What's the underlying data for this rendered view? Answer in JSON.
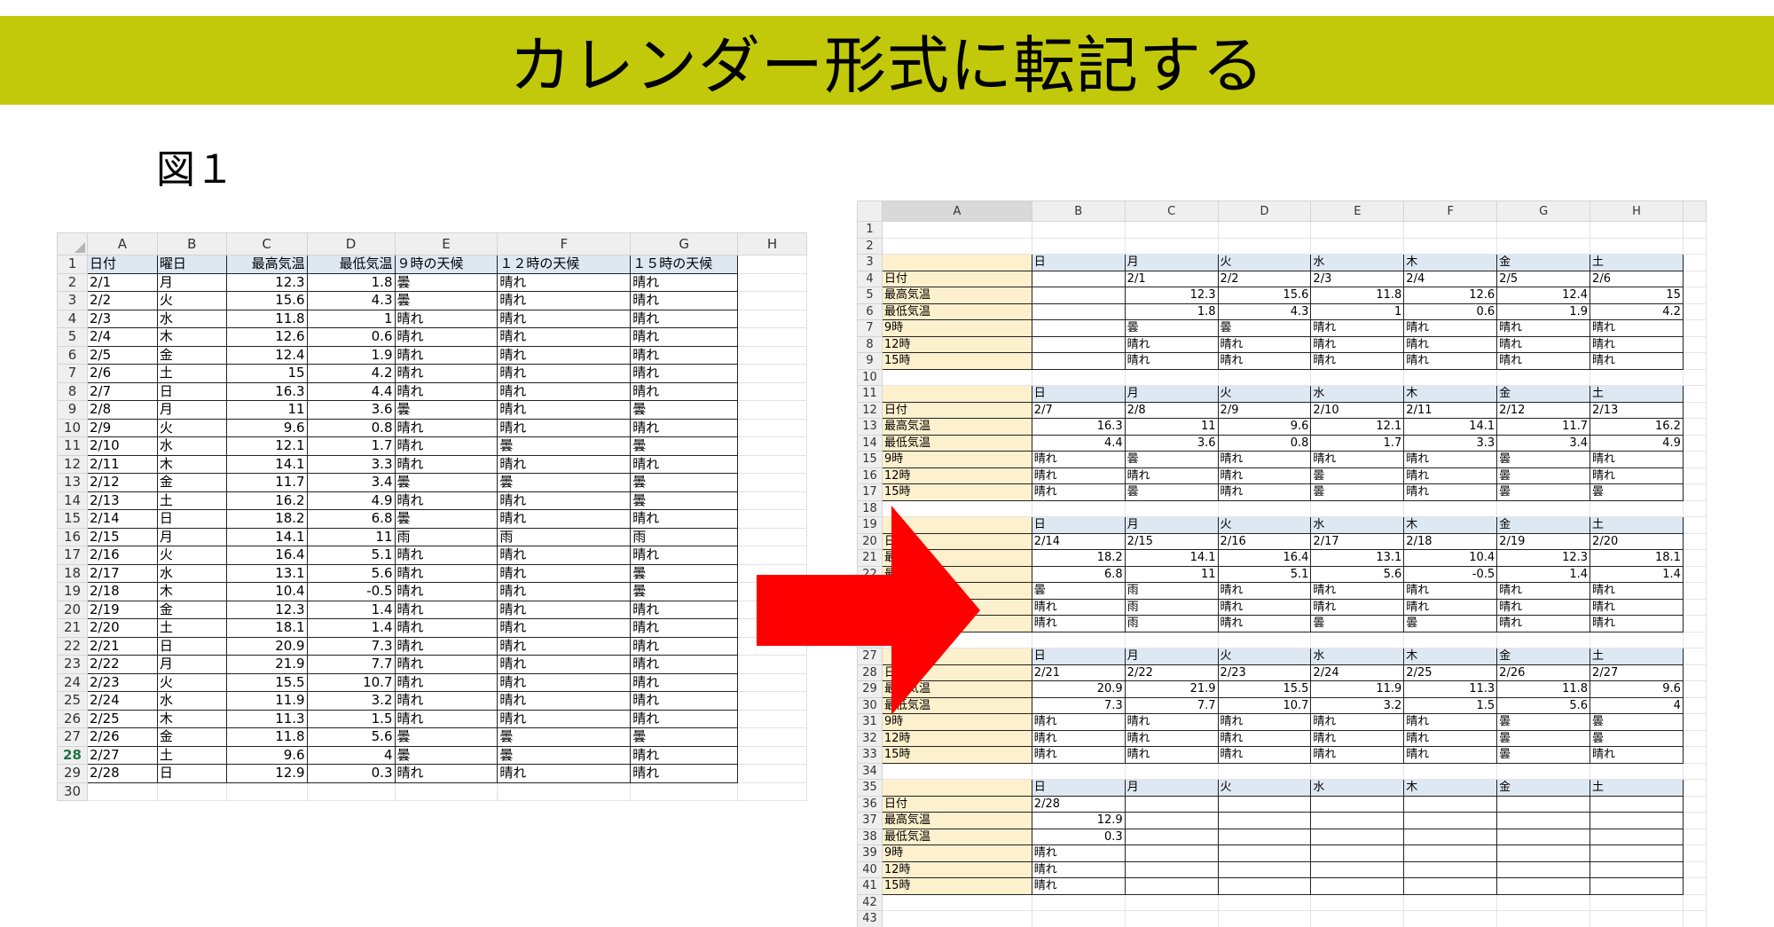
{
  "banner": {
    "title": "カレンダー形式に転記する"
  },
  "figure": {
    "label": "図１"
  },
  "sheet1": {
    "columns": [
      "A",
      "B",
      "C",
      "D",
      "E",
      "F",
      "G",
      "H"
    ],
    "selected_row": "28",
    "rows": [
      {
        "n": "1",
        "cells": [
          "日付",
          "曜日",
          "最高気温",
          "最低気温",
          "９時の天候",
          "１２時の天候",
          "１５時の天候",
          ""
        ]
      },
      {
        "n": "2",
        "cells": [
          "2/1",
          "月",
          "12.3",
          "1.8",
          "曇",
          "晴れ",
          "晴れ",
          ""
        ]
      },
      {
        "n": "3",
        "cells": [
          "2/2",
          "火",
          "15.6",
          "4.3",
          "曇",
          "晴れ",
          "晴れ",
          ""
        ]
      },
      {
        "n": "4",
        "cells": [
          "2/3",
          "水",
          "11.8",
          "1",
          "晴れ",
          "晴れ",
          "晴れ",
          ""
        ]
      },
      {
        "n": "5",
        "cells": [
          "2/4",
          "木",
          "12.6",
          "0.6",
          "晴れ",
          "晴れ",
          "晴れ",
          ""
        ]
      },
      {
        "n": "6",
        "cells": [
          "2/5",
          "金",
          "12.4",
          "1.9",
          "晴れ",
          "晴れ",
          "晴れ",
          ""
        ]
      },
      {
        "n": "7",
        "cells": [
          "2/6",
          "土",
          "15",
          "4.2",
          "晴れ",
          "晴れ",
          "晴れ",
          ""
        ]
      },
      {
        "n": "8",
        "cells": [
          "2/7",
          "日",
          "16.3",
          "4.4",
          "晴れ",
          "晴れ",
          "晴れ",
          ""
        ]
      },
      {
        "n": "9",
        "cells": [
          "2/8",
          "月",
          "11",
          "3.6",
          "曇",
          "晴れ",
          "曇",
          ""
        ]
      },
      {
        "n": "10",
        "cells": [
          "2/9",
          "火",
          "9.6",
          "0.8",
          "晴れ",
          "晴れ",
          "晴れ",
          ""
        ]
      },
      {
        "n": "11",
        "cells": [
          "2/10",
          "水",
          "12.1",
          "1.7",
          "晴れ",
          "曇",
          "曇",
          ""
        ]
      },
      {
        "n": "12",
        "cells": [
          "2/11",
          "木",
          "14.1",
          "3.3",
          "晴れ",
          "晴れ",
          "晴れ",
          ""
        ]
      },
      {
        "n": "13",
        "cells": [
          "2/12",
          "金",
          "11.7",
          "3.4",
          "曇",
          "曇",
          "曇",
          ""
        ]
      },
      {
        "n": "14",
        "cells": [
          "2/13",
          "土",
          "16.2",
          "4.9",
          "晴れ",
          "晴れ",
          "曇",
          ""
        ]
      },
      {
        "n": "15",
        "cells": [
          "2/14",
          "日",
          "18.2",
          "6.8",
          "曇",
          "晴れ",
          "晴れ",
          ""
        ]
      },
      {
        "n": "16",
        "cells": [
          "2/15",
          "月",
          "14.1",
          "11",
          "雨",
          "雨",
          "雨",
          ""
        ]
      },
      {
        "n": "17",
        "cells": [
          "2/16",
          "火",
          "16.4",
          "5.1",
          "晴れ",
          "晴れ",
          "晴れ",
          ""
        ]
      },
      {
        "n": "18",
        "cells": [
          "2/17",
          "水",
          "13.1",
          "5.6",
          "晴れ",
          "晴れ",
          "曇",
          ""
        ]
      },
      {
        "n": "19",
        "cells": [
          "2/18",
          "木",
          "10.4",
          "-0.5",
          "晴れ",
          "晴れ",
          "曇",
          ""
        ]
      },
      {
        "n": "20",
        "cells": [
          "2/19",
          "金",
          "12.3",
          "1.4",
          "晴れ",
          "晴れ",
          "晴れ",
          ""
        ]
      },
      {
        "n": "21",
        "cells": [
          "2/20",
          "土",
          "18.1",
          "1.4",
          "晴れ",
          "晴れ",
          "晴れ",
          ""
        ]
      },
      {
        "n": "22",
        "cells": [
          "2/21",
          "日",
          "20.9",
          "7.3",
          "晴れ",
          "晴れ",
          "晴れ",
          ""
        ]
      },
      {
        "n": "23",
        "cells": [
          "2/22",
          "月",
          "21.9",
          "7.7",
          "晴れ",
          "晴れ",
          "晴れ",
          ""
        ]
      },
      {
        "n": "24",
        "cells": [
          "2/23",
          "火",
          "15.5",
          "10.7",
          "晴れ",
          "晴れ",
          "晴れ",
          ""
        ]
      },
      {
        "n": "25",
        "cells": [
          "2/24",
          "水",
          "11.9",
          "3.2",
          "晴れ",
          "晴れ",
          "晴れ",
          ""
        ]
      },
      {
        "n": "26",
        "cells": [
          "2/25",
          "木",
          "11.3",
          "1.5",
          "晴れ",
          "晴れ",
          "晴れ",
          ""
        ]
      },
      {
        "n": "27",
        "cells": [
          "2/26",
          "金",
          "11.8",
          "5.6",
          "曇",
          "曇",
          "曇",
          ""
        ]
      },
      {
        "n": "28",
        "cells": [
          "2/27",
          "土",
          "9.6",
          "4",
          "曇",
          "曇",
          "晴れ",
          ""
        ]
      },
      {
        "n": "29",
        "cells": [
          "2/28",
          "日",
          "12.9",
          "0.3",
          "晴れ",
          "晴れ",
          "晴れ",
          ""
        ]
      },
      {
        "n": "30",
        "cells": [
          "",
          "",
          "",
          "",
          "",
          "",
          "",
          ""
        ]
      }
    ]
  },
  "sheet2": {
    "columns": [
      "A",
      "B",
      "C",
      "D",
      "E",
      "F",
      "G",
      "H"
    ],
    "labels": [
      "日付",
      "最高気温",
      "最低気温",
      "9時",
      "12時",
      "15時"
    ],
    "weekdays": [
      "日",
      "月",
      "火",
      "水",
      "木",
      "金",
      "土"
    ],
    "weeks": [
      {
        "rows": [
          "3",
          "4",
          "5",
          "6",
          "7",
          "8",
          "9"
        ],
        "blank_row": "10",
        "days": [
          {
            "date": "",
            "hi": "",
            "lo": "",
            "w9": "",
            "w12": "",
            "w15": ""
          },
          {
            "date": "2/1",
            "hi": "12.3",
            "lo": "1.8",
            "w9": "曇",
            "w12": "晴れ",
            "w15": "晴れ"
          },
          {
            "date": "2/2",
            "hi": "15.6",
            "lo": "4.3",
            "w9": "曇",
            "w12": "晴れ",
            "w15": "晴れ"
          },
          {
            "date": "2/3",
            "hi": "11.8",
            "lo": "1",
            "w9": "晴れ",
            "w12": "晴れ",
            "w15": "晴れ"
          },
          {
            "date": "2/4",
            "hi": "12.6",
            "lo": "0.6",
            "w9": "晴れ",
            "w12": "晴れ",
            "w15": "晴れ"
          },
          {
            "date": "2/5",
            "hi": "12.4",
            "lo": "1.9",
            "w9": "晴れ",
            "w12": "晴れ",
            "w15": "晴れ"
          },
          {
            "date": "2/6",
            "hi": "15",
            "lo": "4.2",
            "w9": "晴れ",
            "w12": "晴れ",
            "w15": "晴れ"
          }
        ]
      },
      {
        "rows": [
          "11",
          "12",
          "13",
          "14",
          "15",
          "16",
          "17"
        ],
        "blank_row": "18",
        "days": [
          {
            "date": "2/7",
            "hi": "16.3",
            "lo": "4.4",
            "w9": "晴れ",
            "w12": "晴れ",
            "w15": "晴れ"
          },
          {
            "date": "2/8",
            "hi": "11",
            "lo": "3.6",
            "w9": "曇",
            "w12": "晴れ",
            "w15": "曇"
          },
          {
            "date": "2/9",
            "hi": "9.6",
            "lo": "0.8",
            "w9": "晴れ",
            "w12": "晴れ",
            "w15": "晴れ"
          },
          {
            "date": "2/10",
            "hi": "12.1",
            "lo": "1.7",
            "w9": "晴れ",
            "w12": "曇",
            "w15": "曇"
          },
          {
            "date": "2/11",
            "hi": "14.1",
            "lo": "3.3",
            "w9": "晴れ",
            "w12": "晴れ",
            "w15": "晴れ"
          },
          {
            "date": "2/12",
            "hi": "11.7",
            "lo": "3.4",
            "w9": "曇",
            "w12": "曇",
            "w15": "曇"
          },
          {
            "date": "2/13",
            "hi": "16.2",
            "lo": "4.9",
            "w9": "晴れ",
            "w12": "晴れ",
            "w15": "曇"
          }
        ]
      },
      {
        "rows": [
          "19",
          "20",
          "21",
          "22",
          "23",
          "24",
          "25"
        ],
        "blank_row": "26",
        "days": [
          {
            "date": "2/14",
            "hi": "18.2",
            "lo": "6.8",
            "w9": "曇",
            "w12": "晴れ",
            "w15": "晴れ"
          },
          {
            "date": "2/15",
            "hi": "14.1",
            "lo": "11",
            "w9": "雨",
            "w12": "雨",
            "w15": "雨"
          },
          {
            "date": "2/16",
            "hi": "16.4",
            "lo": "5.1",
            "w9": "晴れ",
            "w12": "晴れ",
            "w15": "晴れ"
          },
          {
            "date": "2/17",
            "hi": "13.1",
            "lo": "5.6",
            "w9": "晴れ",
            "w12": "晴れ",
            "w15": "曇"
          },
          {
            "date": "2/18",
            "hi": "10.4",
            "lo": "-0.5",
            "w9": "晴れ",
            "w12": "晴れ",
            "w15": "曇"
          },
          {
            "date": "2/19",
            "hi": "12.3",
            "lo": "1.4",
            "w9": "晴れ",
            "w12": "晴れ",
            "w15": "晴れ"
          },
          {
            "date": "2/20",
            "hi": "18.1",
            "lo": "1.4",
            "w9": "晴れ",
            "w12": "晴れ",
            "w15": "晴れ"
          }
        ]
      },
      {
        "rows": [
          "27",
          "28",
          "29",
          "30",
          "31",
          "32",
          "33"
        ],
        "blank_row": "34",
        "days": [
          {
            "date": "2/21",
            "hi": "20.9",
            "lo": "7.3",
            "w9": "晴れ",
            "w12": "晴れ",
            "w15": "晴れ"
          },
          {
            "date": "2/22",
            "hi": "21.9",
            "lo": "7.7",
            "w9": "晴れ",
            "w12": "晴れ",
            "w15": "晴れ"
          },
          {
            "date": "2/23",
            "hi": "15.5",
            "lo": "10.7",
            "w9": "晴れ",
            "w12": "晴れ",
            "w15": "晴れ"
          },
          {
            "date": "2/24",
            "hi": "11.9",
            "lo": "3.2",
            "w9": "晴れ",
            "w12": "晴れ",
            "w15": "晴れ"
          },
          {
            "date": "2/25",
            "hi": "11.3",
            "lo": "1.5",
            "w9": "晴れ",
            "w12": "晴れ",
            "w15": "晴れ"
          },
          {
            "date": "2/26",
            "hi": "11.8",
            "lo": "5.6",
            "w9": "曇",
            "w12": "曇",
            "w15": "曇"
          },
          {
            "date": "2/27",
            "hi": "9.6",
            "lo": "4",
            "w9": "曇",
            "w12": "曇",
            "w15": "晴れ"
          }
        ]
      },
      {
        "rows": [
          "35",
          "36",
          "37",
          "38",
          "39",
          "40",
          "41"
        ],
        "blank_row": "42",
        "days": [
          {
            "date": "2/28",
            "hi": "12.9",
            "lo": "0.3",
            "w9": "晴れ",
            "w12": "晴れ",
            "w15": "晴れ"
          },
          {
            "date": "",
            "hi": "",
            "lo": "",
            "w9": "",
            "w12": "",
            "w15": ""
          },
          {
            "date": "",
            "hi": "",
            "lo": "",
            "w9": "",
            "w12": "",
            "w15": ""
          },
          {
            "date": "",
            "hi": "",
            "lo": "",
            "w9": "",
            "w12": "",
            "w15": ""
          },
          {
            "date": "",
            "hi": "",
            "lo": "",
            "w9": "",
            "w12": "",
            "w15": ""
          },
          {
            "date": "",
            "hi": "",
            "lo": "",
            "w9": "",
            "w12": "",
            "w15": ""
          },
          {
            "date": "",
            "hi": "",
            "lo": "",
            "w9": "",
            "w12": "",
            "w15": ""
          }
        ]
      }
    ],
    "extra_rows": [
      "1",
      "2"
    ],
    "tail_row": "43"
  },
  "colors": {
    "banner": "#c2c90a",
    "arrow": "#ff0000",
    "header_fill": "#dde8f3",
    "label_fill": "#fdf0cd"
  }
}
